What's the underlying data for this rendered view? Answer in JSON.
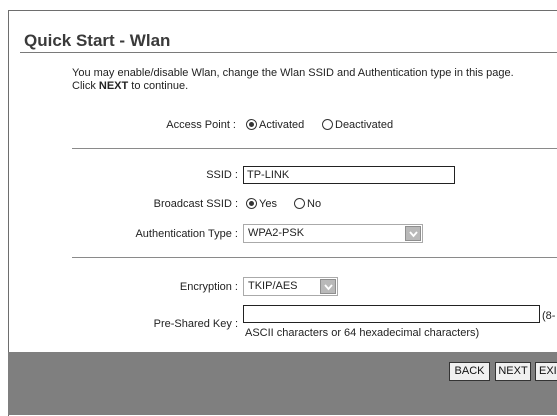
{
  "page": {
    "title": "Quick Start - Wlan",
    "description_line1": "You may enable/disable Wlan, change the Wlan SSID and Authentication type in this page.",
    "description_line2_prefix": "Click ",
    "description_line2_bold": "NEXT",
    "description_line2_suffix": " to continue."
  },
  "access_point": {
    "label": "Access Point :",
    "options": [
      "Activated",
      "Deactivated"
    ],
    "selected": "Activated"
  },
  "ssid": {
    "label": "SSID :",
    "value": "TP-LINK"
  },
  "broadcast_ssid": {
    "label": "Broadcast SSID :",
    "options": [
      "Yes",
      "No"
    ],
    "selected": "Yes"
  },
  "authentication": {
    "label": "Authentication Type :",
    "value": "WPA2-PSK"
  },
  "encryption": {
    "label": "Encryption :",
    "value": "TKIP/AES"
  },
  "psk": {
    "label": "Pre-Shared Key :",
    "value": "",
    "hint_right": "(8-",
    "hint_below": "ASCII characters or 64 hexadecimal characters)"
  },
  "buttons": {
    "back": "BACK",
    "next": "NEXT",
    "exit": "EXI"
  },
  "colors": {
    "footer": "#7f7f7f",
    "title": "#3a3a3a"
  }
}
